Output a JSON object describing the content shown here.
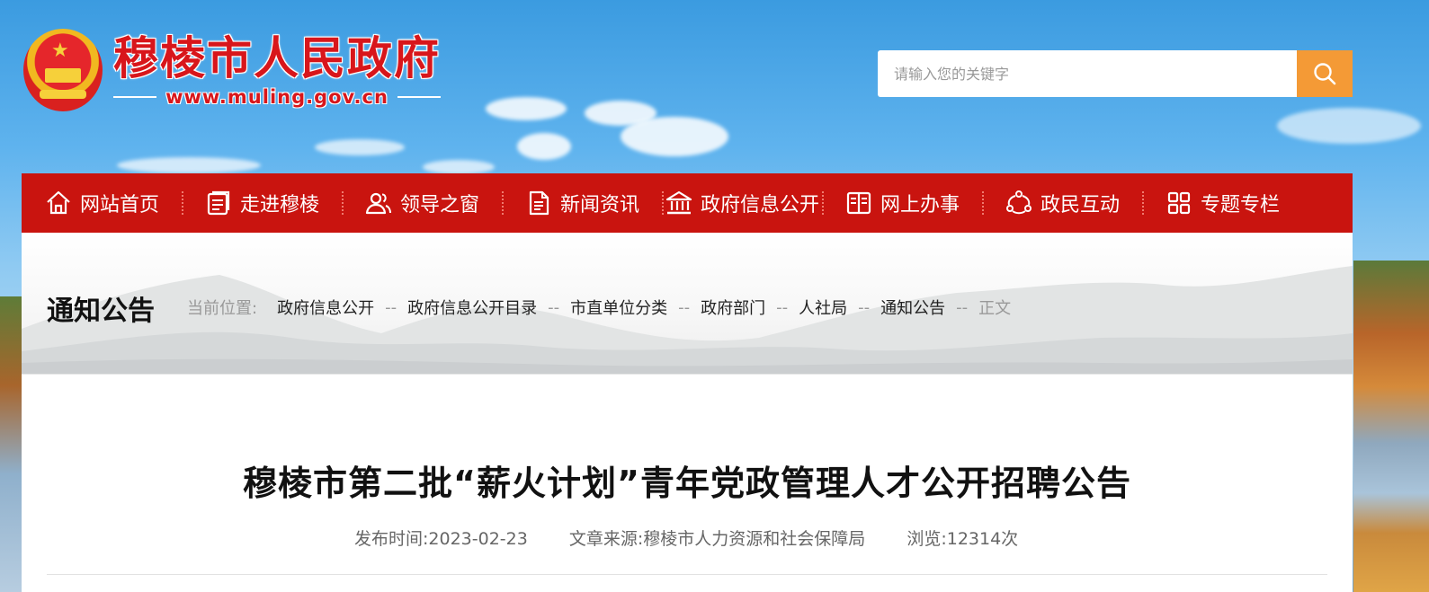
{
  "header": {
    "site_title": "穆棱市人民政府",
    "site_url": "www.muling.gov.cn"
  },
  "search": {
    "placeholder": "请输入您的关键字",
    "icon": "search-icon"
  },
  "nav": {
    "items": [
      {
        "label": "网站首页",
        "icon": "home-icon"
      },
      {
        "label": "走进穆棱",
        "icon": "document-list-icon"
      },
      {
        "label": "领导之窗",
        "icon": "users-icon"
      },
      {
        "label": "新闻资讯",
        "icon": "news-icon"
      },
      {
        "label": "政府信息公开",
        "icon": "government-building-icon"
      },
      {
        "label": "网上办事",
        "icon": "book-icon"
      },
      {
        "label": "政民互动",
        "icon": "interaction-icon"
      },
      {
        "label": "专题专栏",
        "icon": "grid-icon"
      }
    ]
  },
  "section": {
    "title": "通知公告"
  },
  "breadcrumb": {
    "prefix": "当前位置:",
    "separator": "--",
    "items": [
      "政府信息公开",
      "政府信息公开目录",
      "市直单位分类",
      "政府部门",
      "人社局",
      "通知公告"
    ],
    "current": "正文"
  },
  "article": {
    "title": "穆棱市第二批“薪火计划”青年党政管理人才公开招聘公告",
    "publish_date": "发布时间:2023-02-23",
    "source": "文章来源:穆棱市人力资源和社会保障局",
    "views": "浏览:12314次"
  },
  "colors": {
    "nav_bg": "#c9140f",
    "search_button": "#f49a36",
    "brand_red": "#d8161b"
  }
}
